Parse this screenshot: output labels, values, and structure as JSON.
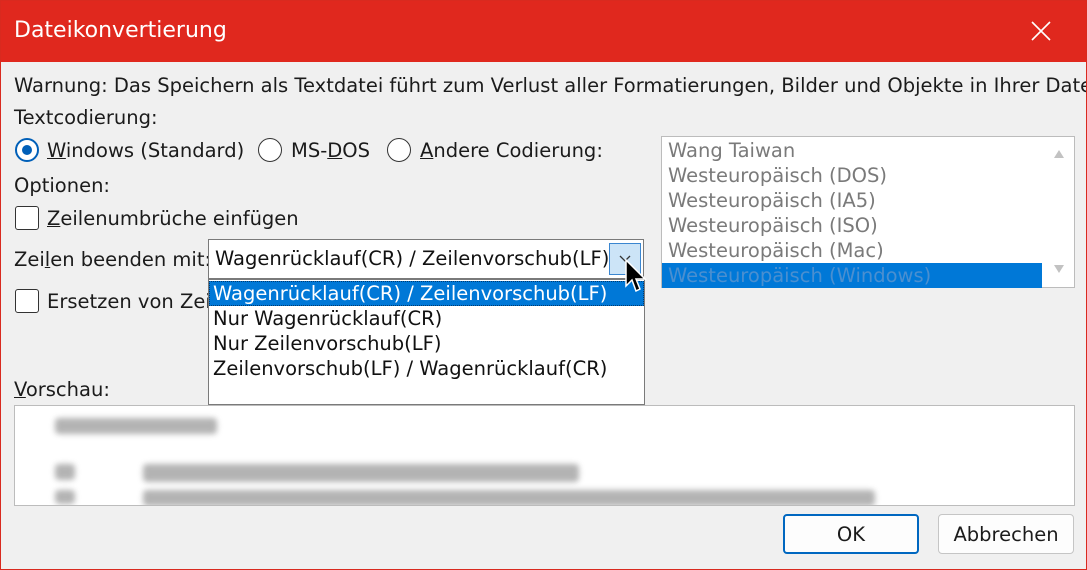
{
  "window": {
    "title": "Dateikonvertierung",
    "titlebar_color": "#e0281e",
    "accent_color": "#0078d7"
  },
  "warning": "Warnung: Das Speichern als Textdatei führt zum Verlust aller Formatierungen, Bilder und Objekte in Ihrer Datei.",
  "encoding": {
    "label": "Textcodierung:",
    "options": [
      {
        "pre": "",
        "accel": "W",
        "post": "indows (Standard)",
        "selected": true
      },
      {
        "pre": "MS-",
        "accel": "D",
        "post": "OS",
        "selected": false
      },
      {
        "pre": "",
        "accel": "A",
        "post": "ndere Codierung:",
        "selected": false
      }
    ],
    "list_items": [
      "Wang Taiwan",
      "Westeuropäisch (DOS)",
      "Westeuropäisch (IA5)",
      "Westeuropäisch (ISO)",
      "Westeuropäisch (Mac)",
      "Westeuropäisch (Windows)"
    ],
    "list_selected_index": 5
  },
  "options": {
    "label": "Optionen:",
    "insert_line_breaks": {
      "pre": "",
      "accel": "Z",
      "post": "eilenumbrüche einfügen",
      "checked": false
    },
    "end_lines": {
      "pre": "Zei",
      "accel": "l",
      "post": "en beenden mit:",
      "value": "Wagenrücklauf(CR) / Zeilenvorschub(LF)"
    },
    "line_end_options": [
      "Wagenrücklauf(CR) / Zeilenvorschub(LF)",
      "Nur Wagenrücklauf(CR)",
      "Nur Zeilenvorschub(LF)",
      "Zeilenvorschub(LF) / Wagenrücklauf(CR)"
    ],
    "line_end_selected_index": 0,
    "replace_chars": {
      "label": "Ersetzen von Zeic",
      "checked": false
    }
  },
  "preview": {
    "pre": "",
    "accel": "V",
    "post": "orschau:"
  },
  "buttons": {
    "ok": "OK",
    "cancel": "Abbrechen"
  },
  "icons": {
    "close": "close-icon",
    "dropdown": "chevron-down-icon",
    "scroll_up": "arrow-up-icon",
    "scroll_down": "arrow-down-icon",
    "cursor": "mouse-pointer-icon"
  }
}
